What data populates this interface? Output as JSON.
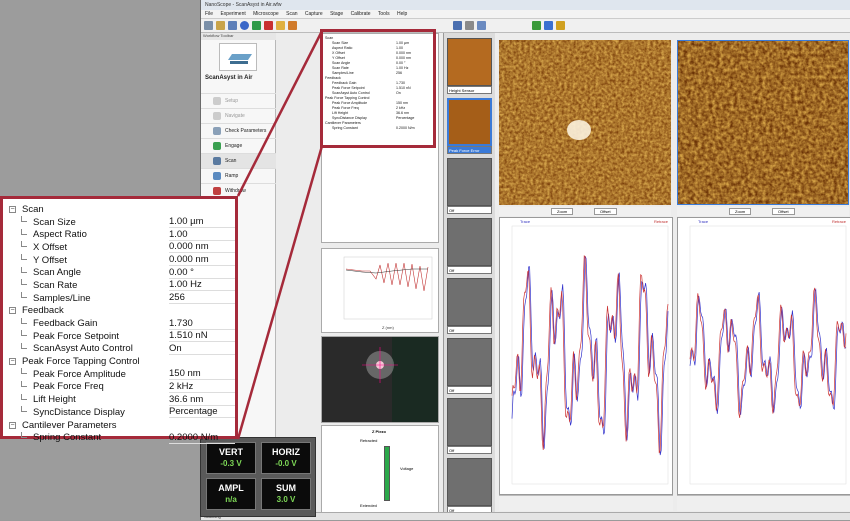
{
  "app": {
    "title": "NanoScope - ScanAsyst in Air.wfw",
    "menu": [
      "File",
      "Experiment",
      "Microscope",
      "Scan",
      "Capture",
      "Stage",
      "Calibrate",
      "Tools",
      "Help"
    ]
  },
  "workflow": {
    "header": "Workflow Toolbar",
    "mode_title": "ScanAsyst in Air",
    "items": [
      "Setup",
      "Navigate",
      "Check Parameters",
      "Engage",
      "Scan",
      "Ramp",
      "Withdraw"
    ]
  },
  "params_small": [
    [
      "Scan",
      ""
    ],
    [
      "Scan Size",
      "1.00 µm"
    ],
    [
      "Aspect Ratio",
      "1.00"
    ],
    [
      "X Offset",
      "0.000 nm"
    ],
    [
      "Y Offset",
      "0.000 nm"
    ],
    [
      "Scan Angle",
      "0.00 °"
    ],
    [
      "Scan Rate",
      "1.00 Hz"
    ],
    [
      "Samples/Line",
      "256"
    ],
    [
      "Feedback",
      ""
    ],
    [
      "Feedback Gain",
      "1.730"
    ],
    [
      "Peak Force Setpoint",
      "1.510 nN"
    ],
    [
      "ScanAsyst Auto Control",
      "On"
    ],
    [
      "Peak Force Tapping Control",
      ""
    ],
    [
      "Peak Force Amplitude",
      "150 nm"
    ],
    [
      "Peak Force Freq",
      "2 kHz"
    ],
    [
      "Lift Height",
      "36.6 nm"
    ],
    [
      "SyncDistance Display",
      "Percentage"
    ],
    [
      "Cantilever Parameters",
      ""
    ],
    [
      "Spring Constant",
      "0.2000 N/m"
    ]
  ],
  "zoom": {
    "scan_group": "Scan",
    "scan_size_label": "Scan Size",
    "scan_size": "1.00 µm",
    "aspect_label": "Aspect Ratio",
    "aspect": "1.00",
    "xoff_label": "X Offset",
    "xoff": "0.000 nm",
    "yoff_label": "Y Offset",
    "yoff": "0.000 nm",
    "angle_label": "Scan Angle",
    "angle": "0.00 °",
    "rate_label": "Scan Rate",
    "rate": "1.00 Hz",
    "samples_label": "Samples/Line",
    "samples": "256",
    "feedback_group": "Feedback",
    "gain_label": "Feedback Gain",
    "gain": "1.730",
    "setpoint_label": "Peak Force Setpoint",
    "setpoint": "1.510 nN",
    "auto_label": "ScanAsyst Auto Control",
    "auto": "On",
    "pft_group": "Peak Force Tapping Control",
    "amp_label": "Peak Force Amplitude",
    "amp": "150 nm",
    "freq_label": "Peak Force Freq",
    "freq": "2 kHz",
    "lift_label": "Lift Height",
    "lift": "36.6 nm",
    "sync_label": "SyncDistance Display",
    "sync": "Percentage",
    "cant_group": "Cantilever Parameters",
    "spring_label": "Spring Constant",
    "spring": "0.2000 N/m"
  },
  "sensor": {
    "vert_label": "VERT",
    "vert": "-0.3 V",
    "horiz_label": "HORIZ",
    "horiz": "-0.0 V",
    "ampl_label": "AMPL",
    "ampl": "n/a",
    "sum_label": "SUM",
    "sum": "3.0 V"
  },
  "zpiezo": {
    "title": "Z Piezo",
    "retracted": "Retracted",
    "extended": "Extended",
    "voltage": "Voltage"
  },
  "channels": {
    "height": "Height Sensor",
    "pf_error": "Peak Force Error",
    "off": "Off"
  },
  "image_buttons": {
    "zoom": "Zoom",
    "offset": "Offset"
  },
  "plot_labels": {
    "trace": "Trace",
    "retrace": "Retrace"
  },
  "status": "Scanning",
  "colors": {
    "callout": "#a52a3a",
    "sensor_value": "#7ed957"
  }
}
